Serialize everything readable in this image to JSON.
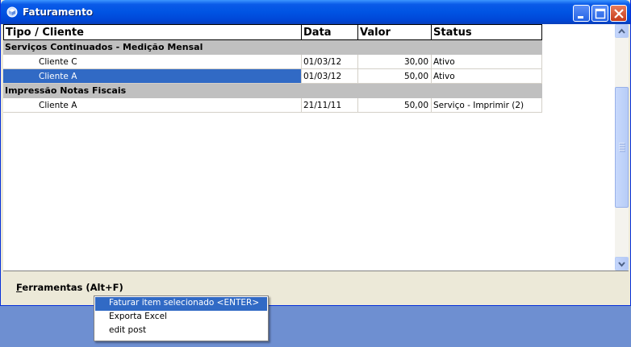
{
  "window": {
    "title": "Faturamento"
  },
  "columns": [
    "Tipo / Cliente",
    "Data",
    "Valor",
    "Status"
  ],
  "groups": [
    {
      "name": "Serviços Continuados - Medição Mensal",
      "rows": [
        {
          "cliente": "Cliente C",
          "data": "01/03/12",
          "valor": "30,00",
          "status": "Ativo"
        },
        {
          "cliente": "Cliente A",
          "data": "01/03/12",
          "valor": "50,00",
          "status": "Ativo",
          "selected": true
        }
      ]
    },
    {
      "name": "Impressão Notas Fiscais",
      "rows": [
        {
          "cliente": "Cliente A",
          "data": "21/11/11",
          "valor": "50,00",
          "status": "Serviço - Imprimir (2)"
        }
      ]
    }
  ],
  "toolbar": {
    "ferramentas_mnemonic": "F",
    "ferramentas_rest": "erramentas (Alt+F)"
  },
  "popup_menu": {
    "items": [
      "Faturar item selecionado  <ENTER>",
      "Exporta Excel",
      "edit post"
    ],
    "highlighted_index": 0
  },
  "colors": {
    "selection": "#316ac5",
    "group_bg": "#c0c0c0",
    "title_bar": "#0054e3"
  }
}
